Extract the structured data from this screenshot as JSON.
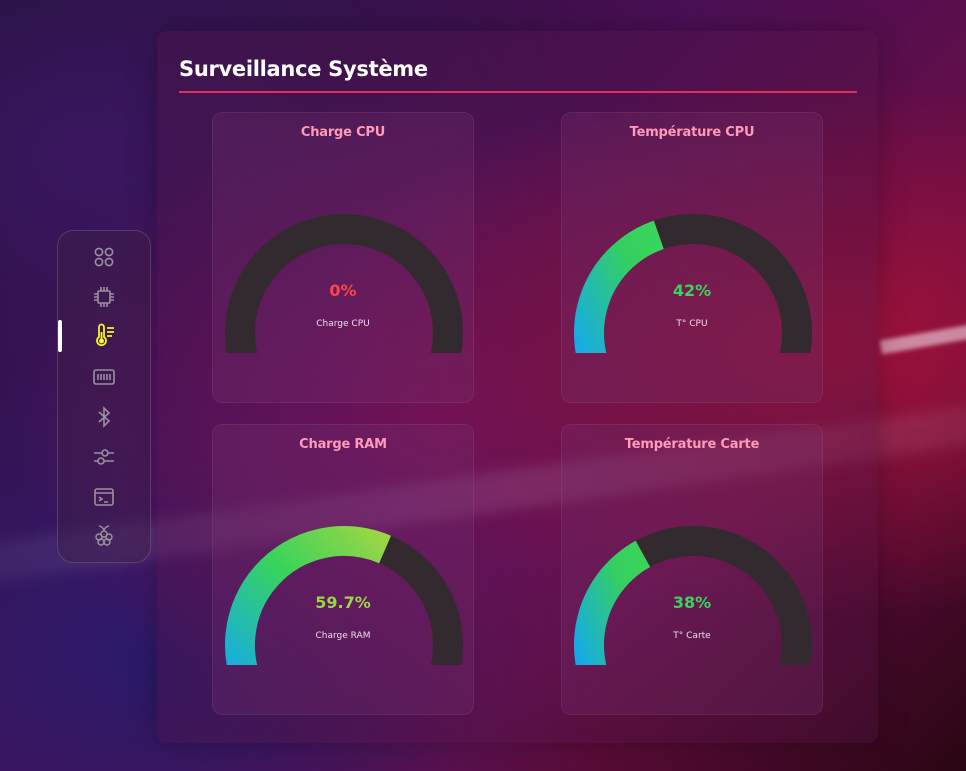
{
  "page": {
    "title": "Surveillance Système"
  },
  "colors": {
    "accent_line": "#e0305a",
    "card_title": "#ff9ab8",
    "value_red": "#ff4545",
    "value_green": "#3ad45c",
    "value_lime": "#9ad645",
    "active_icon": "#f5f52a",
    "track": "#332a30"
  },
  "sidebar": {
    "items": [
      {
        "icon": "dashboard-icon",
        "active": false
      },
      {
        "icon": "cpu-chip-icon",
        "active": false
      },
      {
        "icon": "thermometer-icon",
        "active": true
      },
      {
        "icon": "memory-card-icon",
        "active": false
      },
      {
        "icon": "bluetooth-icon",
        "active": false
      },
      {
        "icon": "sliders-icon",
        "active": false
      },
      {
        "icon": "terminal-icon",
        "active": false
      },
      {
        "icon": "raspberry-pi-icon",
        "active": false
      }
    ]
  },
  "cards": [
    {
      "title": "Charge CPU",
      "value": "0%",
      "label": "Charge CPU",
      "percent": 0
    },
    {
      "title": "Température CPU",
      "value": "42%",
      "label": "T° CPU",
      "percent": 42
    },
    {
      "title": "Charge RAM",
      "value": "59.7%",
      "label": "Charge RAM",
      "percent": 59.7
    },
    {
      "title": "Température Carte",
      "value": "38%",
      "label": "T° Carte",
      "percent": 38
    }
  ]
}
